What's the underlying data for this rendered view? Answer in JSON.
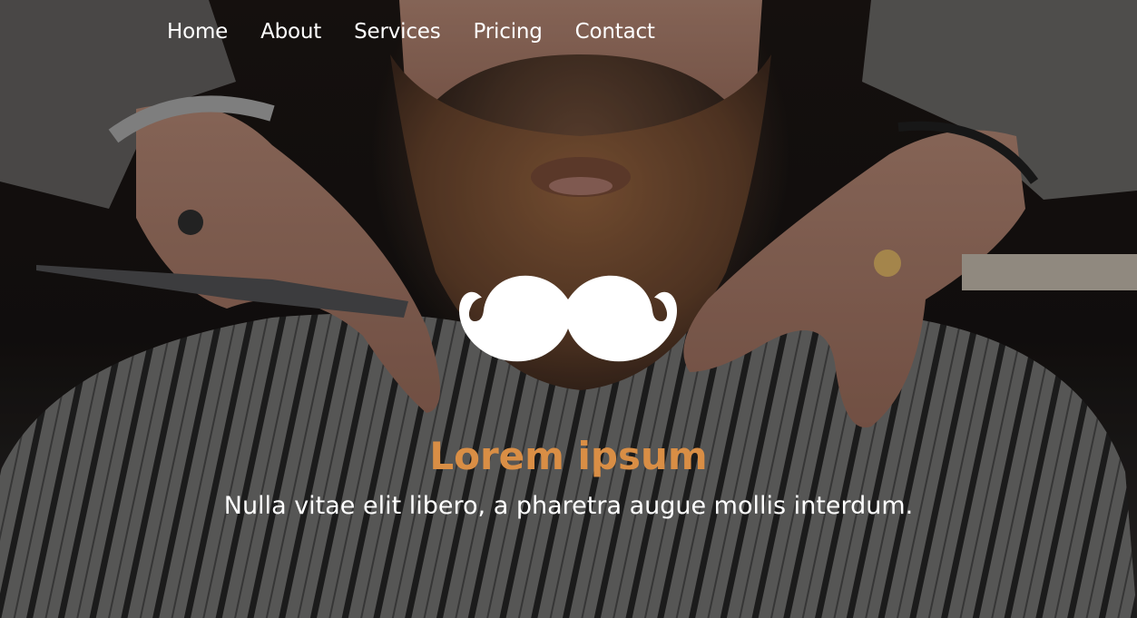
{
  "nav": {
    "items": [
      {
        "label": "Home"
      },
      {
        "label": "About"
      },
      {
        "label": "Services"
      },
      {
        "label": "Pricing"
      },
      {
        "label": "Contact"
      }
    ]
  },
  "hero": {
    "logo_icon": "mustache-icon",
    "title": "Lorem ipsum",
    "subtitle": "Nulla vitae elit libero, a pharetra augue mollis interdum."
  },
  "colors": {
    "accent": "#d98e45",
    "text": "#ffffff"
  }
}
